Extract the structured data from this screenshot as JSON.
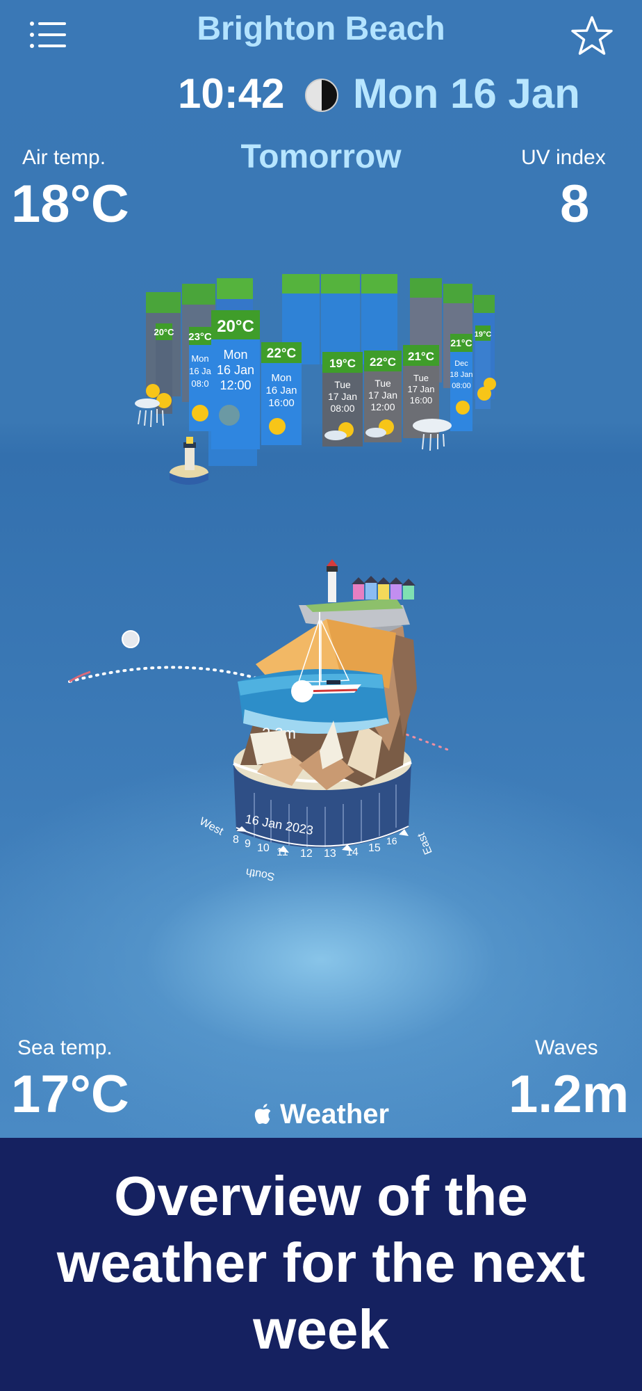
{
  "header": {
    "location": "Brighton Beach",
    "time": "10:42",
    "date": "Mon 16 Jan",
    "moon_icon": "half-moon-icon",
    "menu_icon": "hamburger-menu-icon",
    "favorite_icon": "star-outline-icon"
  },
  "stats": {
    "air_temp_label": "Air temp.",
    "air_temp_value": "18°C",
    "uv_label": "UV index",
    "uv_value": "8",
    "sea_temp_label": "Sea temp.",
    "sea_temp_value": "17°C",
    "waves_label": "Waves",
    "waves_value": "1.2m"
  },
  "period_label": "Tomorrow",
  "forecast": {
    "cards": [
      {
        "temp": "20°C",
        "day": "Mon",
        "date": "16 Jan",
        "time": "12:00",
        "icon": "sun-icon"
      },
      {
        "temp": "22°C",
        "day": "Mon",
        "date": "16 Jan",
        "time": "16:00",
        "icon": "sun-icon"
      },
      {
        "temp": "19°C",
        "day": "Tue",
        "date": "17 Jan",
        "time": "08:00",
        "icon": "partly-cloudy-icon"
      },
      {
        "temp": "22°C",
        "day": "Tue",
        "date": "17 Jan",
        "time": "12:00",
        "icon": "partly-cloudy-icon"
      },
      {
        "temp": "21°C",
        "day": "Tue",
        "date": "17 Jan",
        "time": "16:00",
        "icon": "cloud-rain-icon"
      }
    ],
    "side_left": {
      "temp1": "20°C",
      "temp2": "23°C",
      "day": "Mon",
      "date": "16 Ja",
      "time": "08:0"
    },
    "side_right": {
      "temp1": "21°C",
      "temp2": "19°C",
      "day": "Dec",
      "date": "18 Jan",
      "time": "08:00"
    }
  },
  "scene": {
    "wave_height": "2.3m",
    "dial_date": "16 Jan 2023",
    "hours": [
      "8",
      "9",
      "10",
      "11",
      "12",
      "13",
      "14",
      "15",
      "16"
    ],
    "dir_west": "West",
    "dir_south": "South",
    "dir_east": "East"
  },
  "brand": "Weather",
  "brand_icon": "apple-logo-icon",
  "banner": {
    "line1": "Overview of the",
    "line2": "weather for the next",
    "line3": "week"
  },
  "colors": {
    "background": "#3a78b6",
    "banner": "#152160",
    "accent_text": "#b3e3ff",
    "card_blue": "#2f86e0",
    "card_gray": "#6c6e74",
    "temp_green": "#3f9d2a"
  }
}
